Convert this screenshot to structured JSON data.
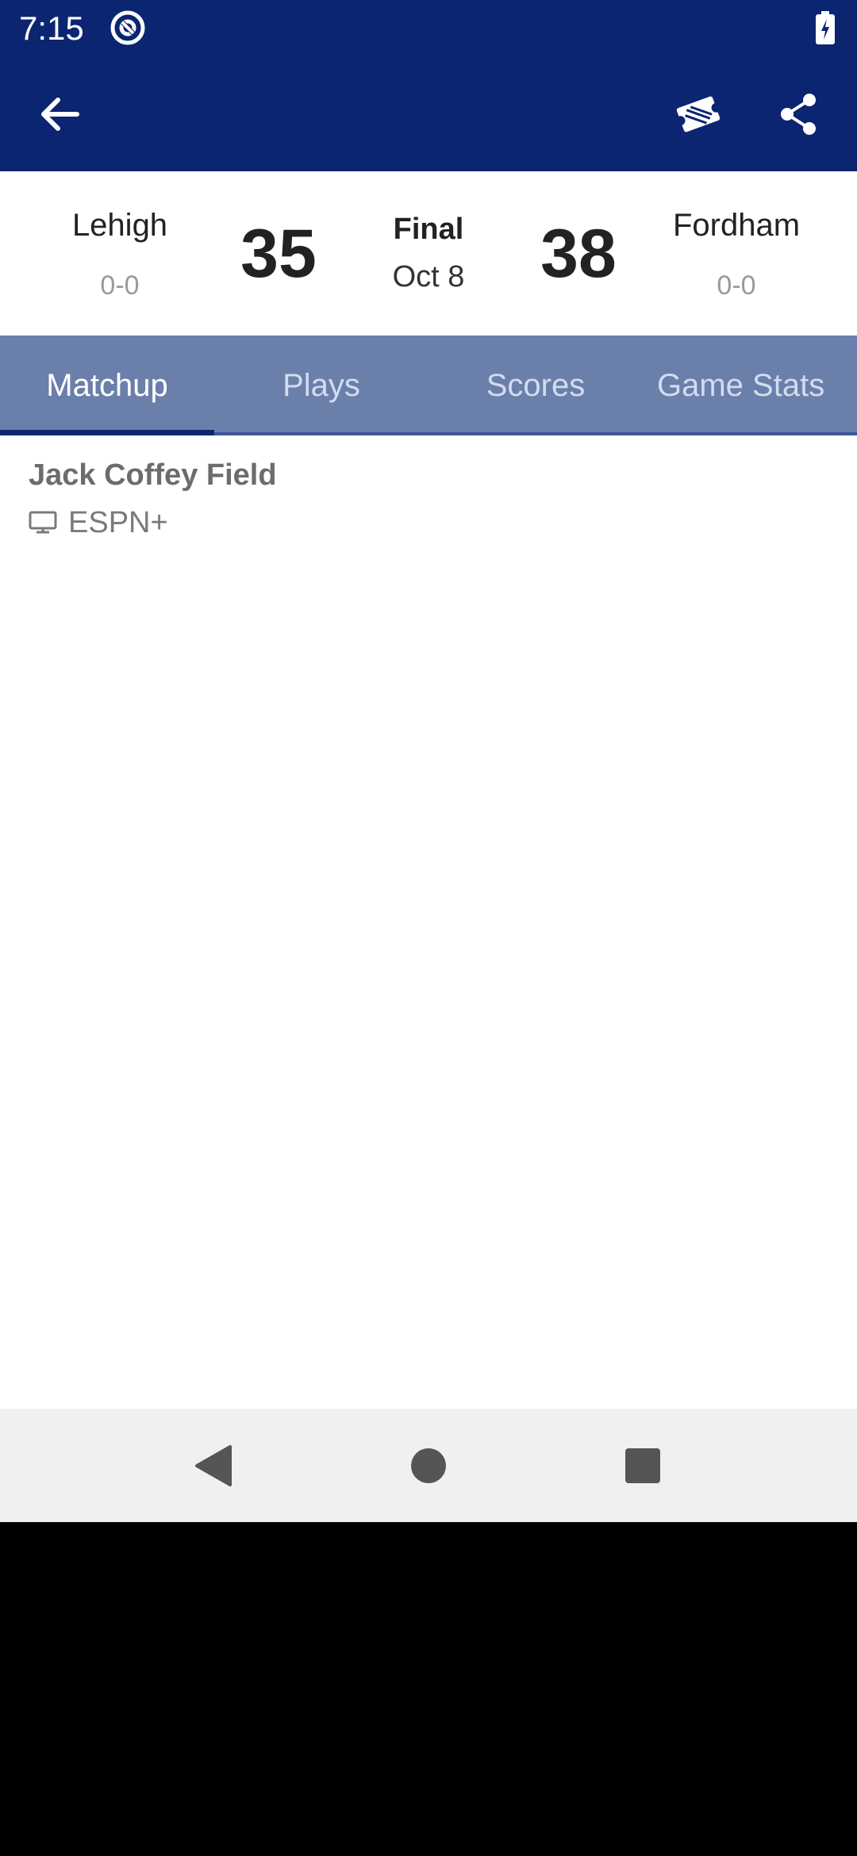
{
  "status_bar": {
    "time": "7:15"
  },
  "toolbar": {
    "back_icon": "arrow-left-icon",
    "tickets_icon": "tickets-icon",
    "share_icon": "share-icon"
  },
  "scoreboard": {
    "away_team": {
      "name": "Lehigh",
      "record": "0-0",
      "score": "35"
    },
    "home_team": {
      "name": "Fordham",
      "record": "0-0",
      "score": "38"
    },
    "status": "Final",
    "date": "Oct 8"
  },
  "tabs": [
    {
      "label": "Matchup",
      "active": true
    },
    {
      "label": "Plays",
      "active": false
    },
    {
      "label": "Scores",
      "active": false
    },
    {
      "label": "Game Stats",
      "active": false
    }
  ],
  "matchup": {
    "venue": "Jack Coffey Field",
    "broadcast": "ESPN+",
    "broadcast_icon": "tv-icon"
  },
  "colors": {
    "header_bg": "#0b2571",
    "tab_bar_bg": "#6b7fab",
    "nav_bar_bg": "#f0f0f0"
  }
}
